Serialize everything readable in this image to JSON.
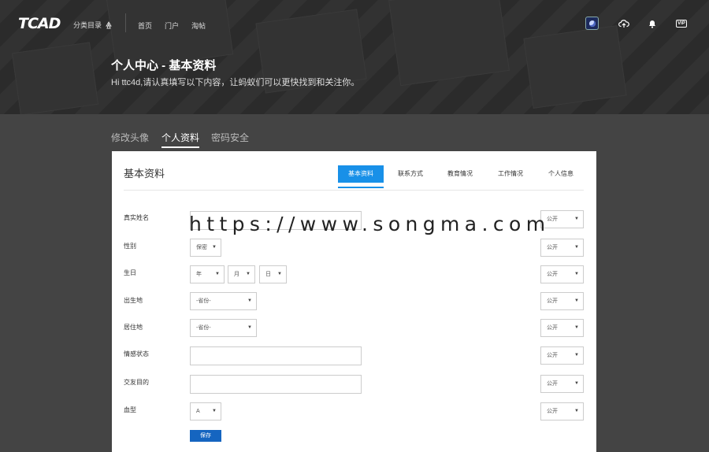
{
  "header": {
    "logo": "TCAD",
    "category_label": "分类目录",
    "nav": [
      "首页",
      "门户",
      "淘帖"
    ],
    "vip_label": "VIP"
  },
  "hero": {
    "title": "个人中心 - 基本资料",
    "subtitle": "Hi ttc4d,请认真填写以下内容，让蚂蚁们可以更快找到和关注你。"
  },
  "tabs": [
    "修改头像",
    "个人资料",
    "密码安全"
  ],
  "active_tab": 1,
  "card": {
    "title": "基本资料",
    "subtabs": [
      "基本资料",
      "联系方式",
      "教育情况",
      "工作情况",
      "个人信息"
    ],
    "active_subtab": 0,
    "fields": {
      "realname": "真实姓名",
      "gender": "性别",
      "birthday": "生日",
      "birthplace": "出生地",
      "residence": "居住地",
      "relationship": "情感状态",
      "purpose": "交友目的",
      "blood": "血型"
    },
    "gender_value": "保密",
    "birth_year": "年",
    "birth_month": "月",
    "birth_day": "日",
    "province_placeholder": "-省份-",
    "residence_placeholder": "-省份-",
    "blood_value": "A",
    "privacy_value": "公开",
    "save_label": "保存"
  },
  "watermark": "https://www.songma.com",
  "colors": {
    "accent": "#1890e8",
    "save": "#1565c0",
    "hero_bg": "#2b2b2b"
  }
}
